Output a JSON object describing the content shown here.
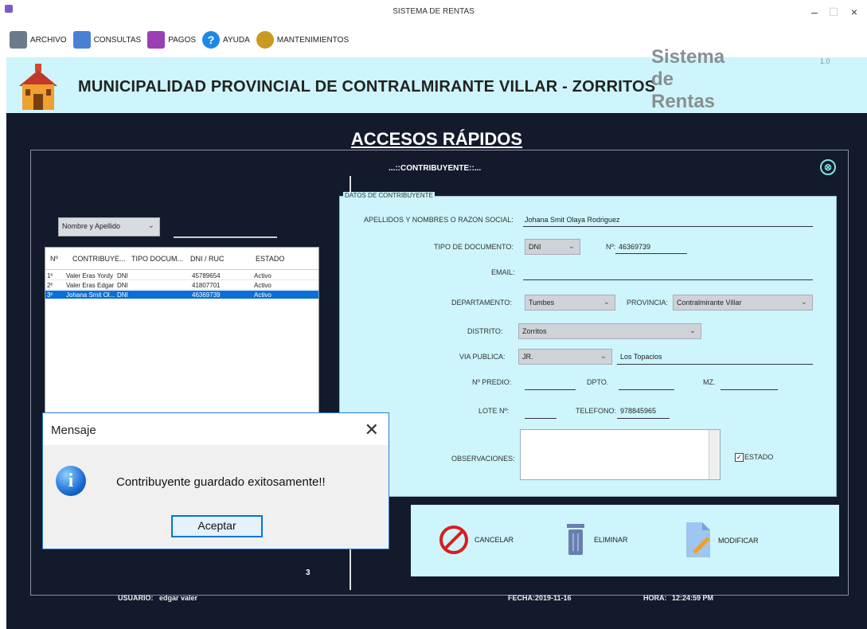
{
  "window": {
    "title": "SISTEMA DE RENTAS",
    "minimize": "–",
    "maximize": "☐",
    "close": "×"
  },
  "menu": [
    {
      "label": "ARCHIVO",
      "color": "#6b7b8c"
    },
    {
      "label": "CONSULTAS",
      "color": "#4a7fd6"
    },
    {
      "label": "PAGOS",
      "color": "#9b3fb5"
    },
    {
      "label": "AYUDA",
      "color": "#1e88e5"
    },
    {
      "label": "MANTENIMIENTOS",
      "color": "#c99a20"
    }
  ],
  "banner": {
    "municipality": "MUNICIPALIDAD PROVINCIAL DE CONTRALMIRANTE VILLAR - ZORRITOS",
    "system": "Sistema de Rentas",
    "version": "1.0"
  },
  "main": {
    "title": "ACCESOS RÁPIDOS",
    "section_title": "...::CONTRIBUYENTE::...",
    "close_icon": "⊗"
  },
  "search": {
    "filter_value": "Nombre y Apellido"
  },
  "table": {
    "headers": [
      "Nº",
      "CONTRIBUYE...",
      "TIPO DOCUM...",
      "DNI / RUC",
      "ESTADO"
    ],
    "rows": [
      [
        "1º",
        "Valer Eras Yordy",
        "DNI",
        "45789654",
        "Activo"
      ],
      [
        "2º",
        "Valer Eras Edgar",
        "DNI",
        "41807701",
        "Activo"
      ],
      [
        "3º",
        "Johana Smit Ol...",
        "DNI",
        "46369739",
        "Activo"
      ]
    ],
    "count": "3"
  },
  "form": {
    "legend": "DATOS DE CONTRIBUYENTE",
    "name_label": "APELLIDOS Y NOMBRES O RAZON SOCIAL:",
    "name_value": "Johana Smit Olaya Rodriguez",
    "doc_type_label": "TIPO DE DOCUMENTO:",
    "doc_type_value": "DNI",
    "doc_num_label": "Nº:",
    "doc_num_value": "46369739",
    "email_label": "EMAIL:",
    "email_value": "",
    "dept_label": "DEPARTAMENTO:",
    "dept_value": "Tumbes",
    "prov_label": "PROVINCIA:",
    "prov_value": "Contralmirante Villar",
    "dist_label": "DISTRITO:",
    "dist_value": "Zorritos",
    "via_label": "VIA PUBLICA:",
    "via_type": "JR.",
    "via_value": "Los Topacios",
    "predio_label": "Nº PREDIO:",
    "dpto_label": "DPTO.",
    "mz_label": "MZ.",
    "lote_label": "LOTE Nº:",
    "tel_label": "TELEFONO:",
    "tel_value": "978845965",
    "obs_label": "OBSERVACIONES:",
    "estado_label": "ESTADO",
    "estado_check": "✓"
  },
  "actions": {
    "cancel": "CANCELAR",
    "delete": "ELIMINAR",
    "modify": "MODIFICAR"
  },
  "footer": {
    "user_label": "USUARIO:",
    "user_value": "edgar valer",
    "date_label": "FECHA:",
    "date_value": "2019-11-16",
    "time_label": "HORA:",
    "time_value": "12:24:59 PM"
  },
  "dialog": {
    "title": "Mensaje",
    "message": "Contribuyente guardado exitosamente!!",
    "button": "Aceptar",
    "icon": "i",
    "close": "✕"
  }
}
